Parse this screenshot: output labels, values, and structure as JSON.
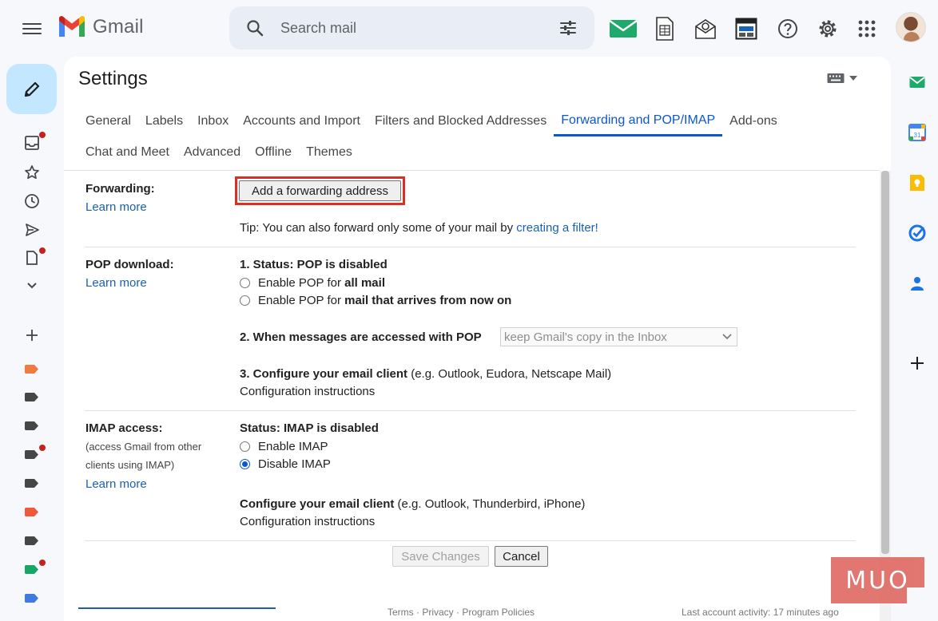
{
  "app": {
    "logo_text": "Gmail",
    "brand_colors": {
      "red": "#ea4335",
      "blue": "#4285f4",
      "green": "#34a853",
      "yellow": "#fbbc04"
    }
  },
  "search": {
    "placeholder": "Search mail"
  },
  "page": {
    "title": "Settings"
  },
  "tabs": [
    {
      "label": "General"
    },
    {
      "label": "Labels"
    },
    {
      "label": "Inbox"
    },
    {
      "label": "Accounts and Import"
    },
    {
      "label": "Filters and Blocked Addresses"
    },
    {
      "label": "Forwarding and POP/IMAP",
      "active": true
    },
    {
      "label": "Add-ons"
    },
    {
      "label": "Chat and Meet"
    },
    {
      "label": "Advanced"
    },
    {
      "label": "Offline"
    },
    {
      "label": "Themes"
    }
  ],
  "forwarding": {
    "label": "Forwarding:",
    "learn_more": "Learn more",
    "add_button": "Add a forwarding address",
    "tip_prefix": "Tip: You can also forward only some of your mail by ",
    "tip_link": "creating a filter!"
  },
  "pop": {
    "label": "POP download:",
    "learn_more": "Learn more",
    "status": "1. Status: POP is disabled",
    "option1_prefix": "Enable POP for ",
    "option1_bold": "all mail",
    "option2_prefix": "Enable POP for ",
    "option2_bold": "mail that arrives from now on",
    "step2_label": "2. When messages are accessed with POP",
    "step2_select": "keep Gmail's copy in the Inbox",
    "step3_label": "3. Configure your email client",
    "step3_note": " (e.g. Outlook, Eudora, Netscape Mail)",
    "config_link": "Configuration instructions"
  },
  "imap": {
    "label": "IMAP access:",
    "sub1": "(access Gmail from other",
    "sub2": "clients using IMAP)",
    "learn_more": "Learn more",
    "status": "Status: IMAP is disabled",
    "enable": "Enable IMAP",
    "disable": "Disable IMAP",
    "selected": "Disable IMAP",
    "configure_label": "Configure your email client",
    "configure_note": " (e.g. Outlook, Thunderbird, iPhone)",
    "config_link": "Configuration instructions"
  },
  "actions": {
    "save": "Save Changes",
    "cancel": "Cancel"
  },
  "footer": {
    "links": "Terms · Privacy · Program Policies",
    "activity": "Last account activity: 17 minutes ago"
  },
  "watermark": "MUO"
}
